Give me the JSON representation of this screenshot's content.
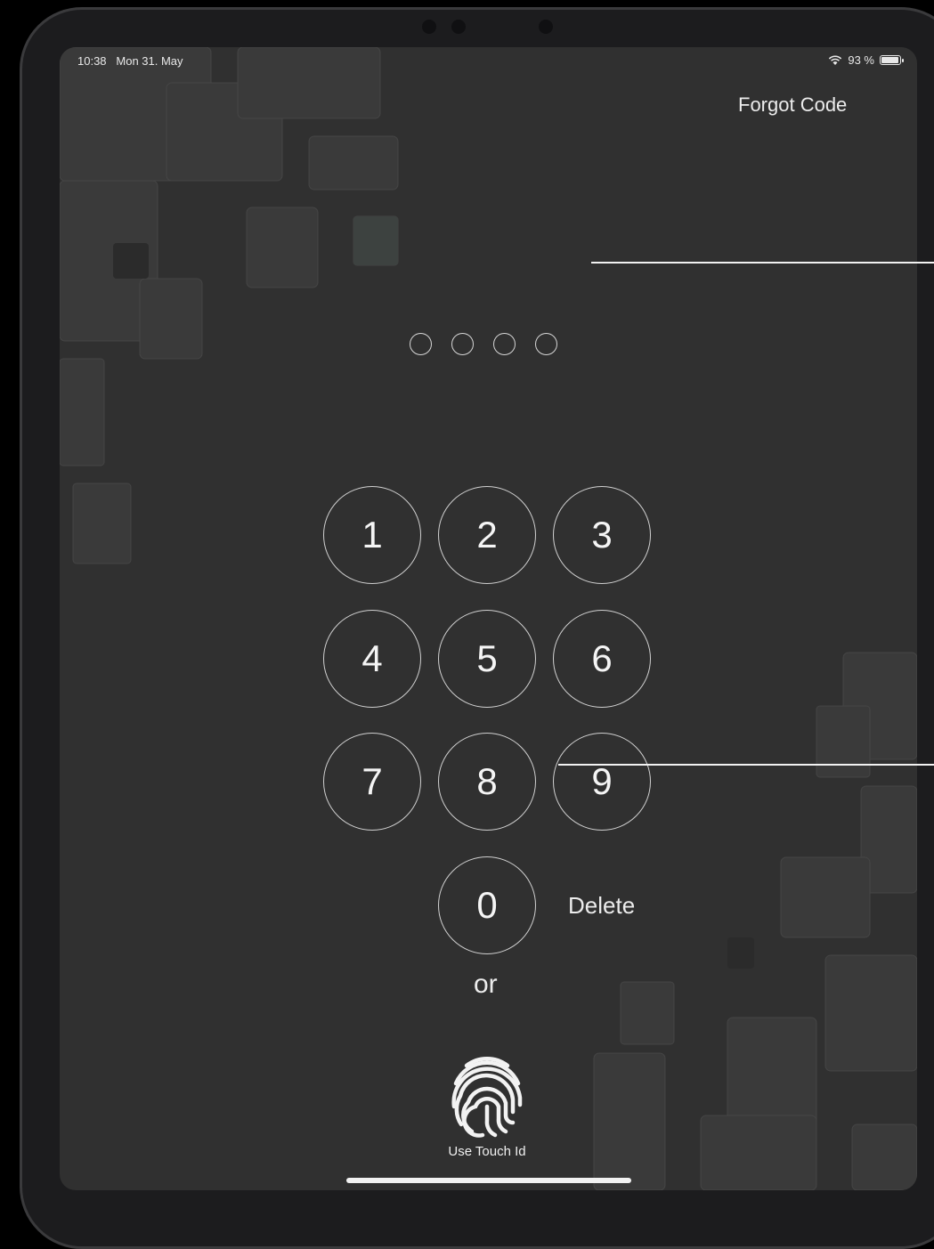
{
  "status_bar": {
    "time": "10:38",
    "date": "Mon 31. May",
    "battery_percent": "93 %",
    "battery_level": 0.93,
    "wifi_icon": "wifi-icon",
    "battery_icon": "battery-icon"
  },
  "header": {
    "forgot_label": "Forgot Code"
  },
  "passcode": {
    "digit_count": 4,
    "entered": 0
  },
  "keypad": {
    "keys": [
      "1",
      "2",
      "3",
      "4",
      "5",
      "6",
      "7",
      "8",
      "9",
      "0"
    ],
    "delete_label": "Delete"
  },
  "alt": {
    "or_label": "or",
    "touch_id_label": "Use Touch Id",
    "touch_id_icon": "fingerprint-icon"
  },
  "colors": {
    "background": "#303030",
    "foreground": "#ececec"
  }
}
